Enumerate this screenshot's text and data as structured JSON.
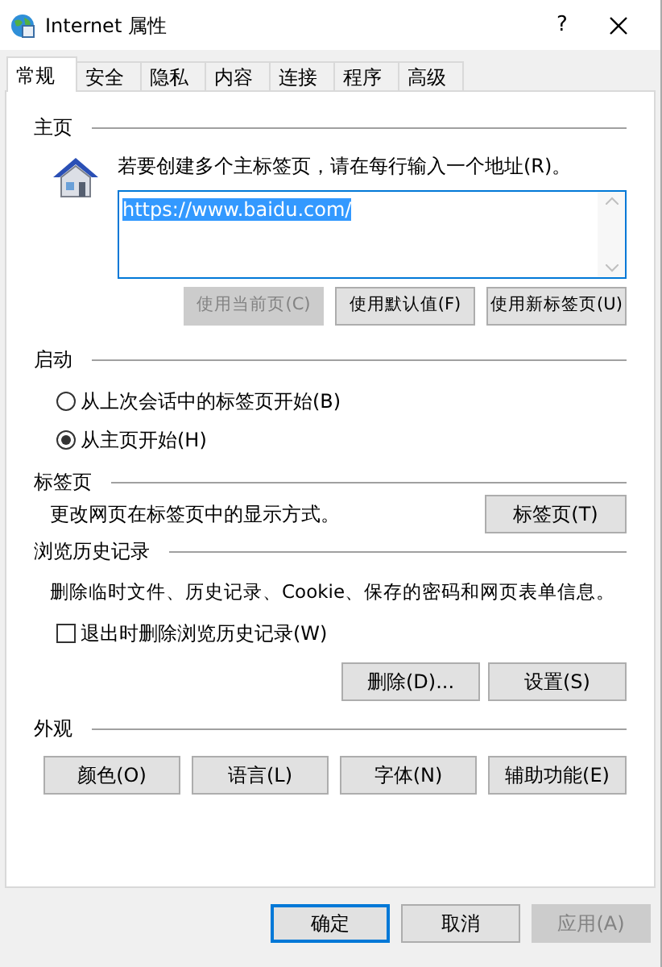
{
  "window": {
    "title": "Internet 属性",
    "help": "?"
  },
  "tabs": [
    {
      "label": "常规",
      "selected": true
    },
    {
      "label": "安全",
      "selected": false
    },
    {
      "label": "隐私",
      "selected": false
    },
    {
      "label": "内容",
      "selected": false
    },
    {
      "label": "连接",
      "selected": false
    },
    {
      "label": "程序",
      "selected": false
    },
    {
      "label": "高级",
      "selected": false
    }
  ],
  "home": {
    "heading": "主页",
    "description": "若要创建多个主标签页，请在每行输入一个地址(R)。",
    "value": "https://www.baidu.com/",
    "buttons": [
      {
        "label": "使用当前页(C)",
        "disabled": true
      },
      {
        "label": "使用默认值(F)",
        "disabled": false
      },
      {
        "label": "使用新标签页(U)",
        "disabled": false
      }
    ]
  },
  "startup": {
    "heading": "启动",
    "options": [
      {
        "label": "从上次会话中的标签页开始(B)",
        "selected": false
      },
      {
        "label": "从主页开始(H)",
        "selected": true
      }
    ]
  },
  "tab_settings": {
    "heading": "标签页",
    "description": "更改网页在标签页中的显示方式。",
    "button": "标签页(T)"
  },
  "history": {
    "heading": "浏览历史记录",
    "description": "删除临时文件、历史记录、Cookie、保存的密码和网页表单信息。",
    "checkbox": {
      "label": "退出时删除浏览历史记录(W)",
      "checked": false
    },
    "buttons": [
      "删除(D)...",
      "设置(S)"
    ]
  },
  "appearance": {
    "heading": "外观",
    "buttons": [
      "颜色(O)",
      "语言(L)",
      "字体(N)",
      "辅助功能(E)"
    ]
  },
  "footer": [
    {
      "label": "确定",
      "disabled": false,
      "default": true
    },
    {
      "label": "取消",
      "disabled": false,
      "default": false
    },
    {
      "label": "应用(A)",
      "disabled": true,
      "default": false
    }
  ]
}
